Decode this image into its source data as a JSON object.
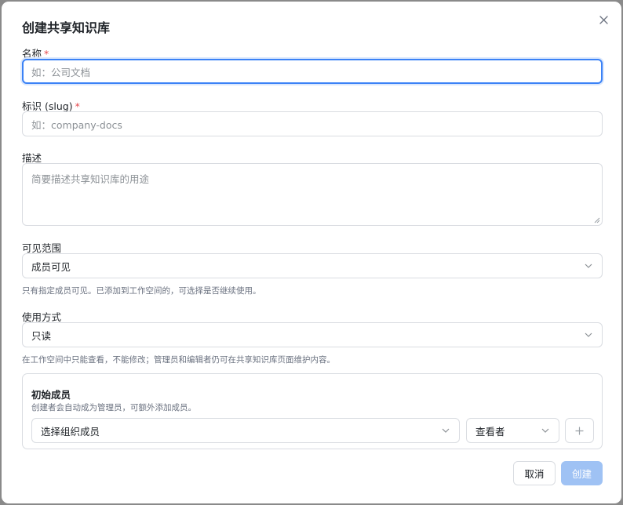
{
  "dialog": {
    "title": "创建共享知识库",
    "close_icon": "close-icon"
  },
  "form": {
    "name": {
      "label": "名称",
      "required_mark": "*",
      "placeholder": "如：公司文档",
      "value": ""
    },
    "slug": {
      "label": "标识 (slug)",
      "required_mark": "*",
      "placeholder": "如：company-docs",
      "value": ""
    },
    "description": {
      "label": "描述",
      "placeholder": "简要描述共享知识库的用途",
      "value": ""
    },
    "visibility": {
      "label": "可见范围",
      "selected": "成员可见",
      "help": "只有指定成员可见。已添加到工作空间的，可选择是否继续使用。"
    },
    "usage": {
      "label": "使用方式",
      "selected": "只读",
      "help": "在工作空间中只能查看，不能修改；管理员和编辑者仍可在共享知识库页面维护内容。"
    },
    "members": {
      "title": "初始成员",
      "description": "创建者会自动成为管理员，可额外添加成员。",
      "member_select_placeholder": "选择组织成员",
      "role_selected": "查看者",
      "add_icon": "plus-icon"
    }
  },
  "actions": {
    "cancel_label": "取消",
    "create_label": "创建"
  },
  "colors": {
    "accent": "#3b82f6",
    "required": "#e5484d",
    "create_disabled_bg": "#9fc2f4"
  }
}
